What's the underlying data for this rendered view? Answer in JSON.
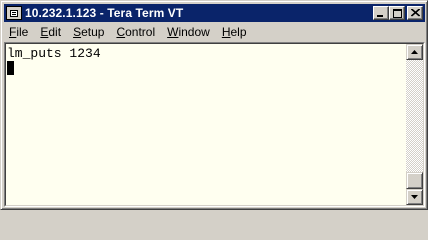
{
  "window": {
    "title": "10.232.1.123 - Tera Term VT",
    "icon": "teraterm-app-icon"
  },
  "title_buttons": {
    "minimize_icon": "minimize-icon",
    "maximize_icon": "maximize-icon",
    "close_icon": "close-icon"
  },
  "menu": {
    "items": [
      {
        "underline": "F",
        "rest": "ile"
      },
      {
        "underline": "E",
        "rest": "dit"
      },
      {
        "underline": "S",
        "rest": "etup"
      },
      {
        "underline": "C",
        "rest": "ontrol"
      },
      {
        "underline": "W",
        "rest": "indow"
      },
      {
        "underline": "H",
        "rest": "elp"
      }
    ]
  },
  "terminal": {
    "lines": [
      "lm_puts 1234"
    ],
    "background": "#fffff0",
    "foreground": "#000000"
  },
  "scrollbar": {
    "up_icon": "scroll-up-arrow-icon",
    "down_icon": "scroll-down-arrow-icon"
  },
  "colors": {
    "titlebar": "#0a246a",
    "chrome": "#d4d0c8"
  }
}
